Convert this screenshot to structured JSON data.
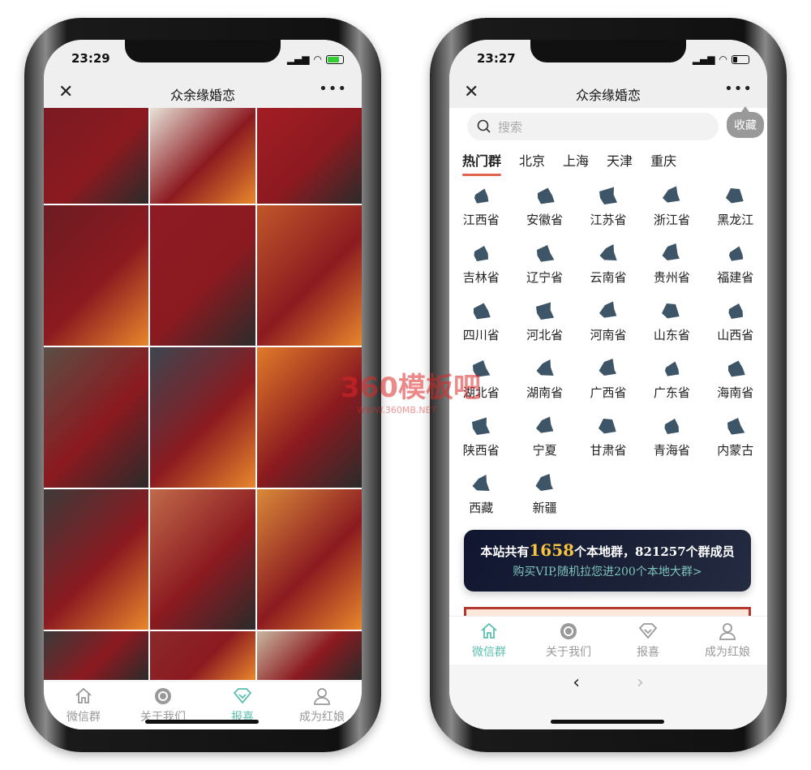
{
  "left": {
    "time": "23:29",
    "title": "众余缘婚恋",
    "close_icon": "close-icon",
    "more_icon": "more-icon",
    "photos": [
      "#7a1a22",
      "#e8e2d8",
      "#a31d24",
      "#6b1c22",
      "#8e1b24",
      "#c0572a",
      "#5a4f45",
      "#3c4650",
      "#e07a2a",
      "#3d3a3a",
      "#c06a4a",
      "#d98a3a",
      "#3a3a3a",
      "#8a2a2a",
      "#c9b8a0"
    ],
    "tabs": [
      {
        "label": "微信群",
        "icon": "home-icon"
      },
      {
        "label": "关于我们",
        "icon": "refresh-circle-icon"
      },
      {
        "label": "报喜",
        "icon": "diamond-icon",
        "active": true
      },
      {
        "label": "成为红娘",
        "icon": "user-icon"
      }
    ]
  },
  "right": {
    "time": "23:27",
    "title": "众余缘婚恋",
    "search_placeholder": "搜索",
    "favorite": "收藏",
    "city_tabs": [
      "热门群",
      "北京",
      "上海",
      "天津",
      "重庆"
    ],
    "provinces": [
      "江西省",
      "安徽省",
      "江苏省",
      "浙江省",
      "黑龙江",
      "吉林省",
      "辽宁省",
      "云南省",
      "贵州省",
      "福建省",
      "四川省",
      "河北省",
      "河南省",
      "山东省",
      "山西省",
      "湖北省",
      "湖南省",
      "广西省",
      "广东省",
      "海南省",
      "陕西省",
      "宁夏",
      "甘肃省",
      "青海省",
      "内蒙古",
      "西藏",
      "新疆"
    ],
    "banner": {
      "prefix": "本站共有",
      "groups": "1658",
      "middle": "个本地群，821257个群成员",
      "cta": "购买VIP,随机拉您进200个本地大群>"
    },
    "tabs": [
      {
        "label": "微信群",
        "icon": "home-icon",
        "active": true
      },
      {
        "label": "关于我们",
        "icon": "refresh-circle-icon"
      },
      {
        "label": "报喜",
        "icon": "diamond-icon"
      },
      {
        "label": "成为红娘",
        "icon": "user-icon"
      }
    ],
    "back": "‹",
    "forward": "›"
  },
  "watermark": {
    "text": "360模板吧",
    "url": "WWW.360MB.NET"
  },
  "colors": {
    "accent": "#5bbfb0",
    "map": "#3d5566",
    "tab_underline": "#e0654d",
    "banner_number": "#f6c343"
  }
}
